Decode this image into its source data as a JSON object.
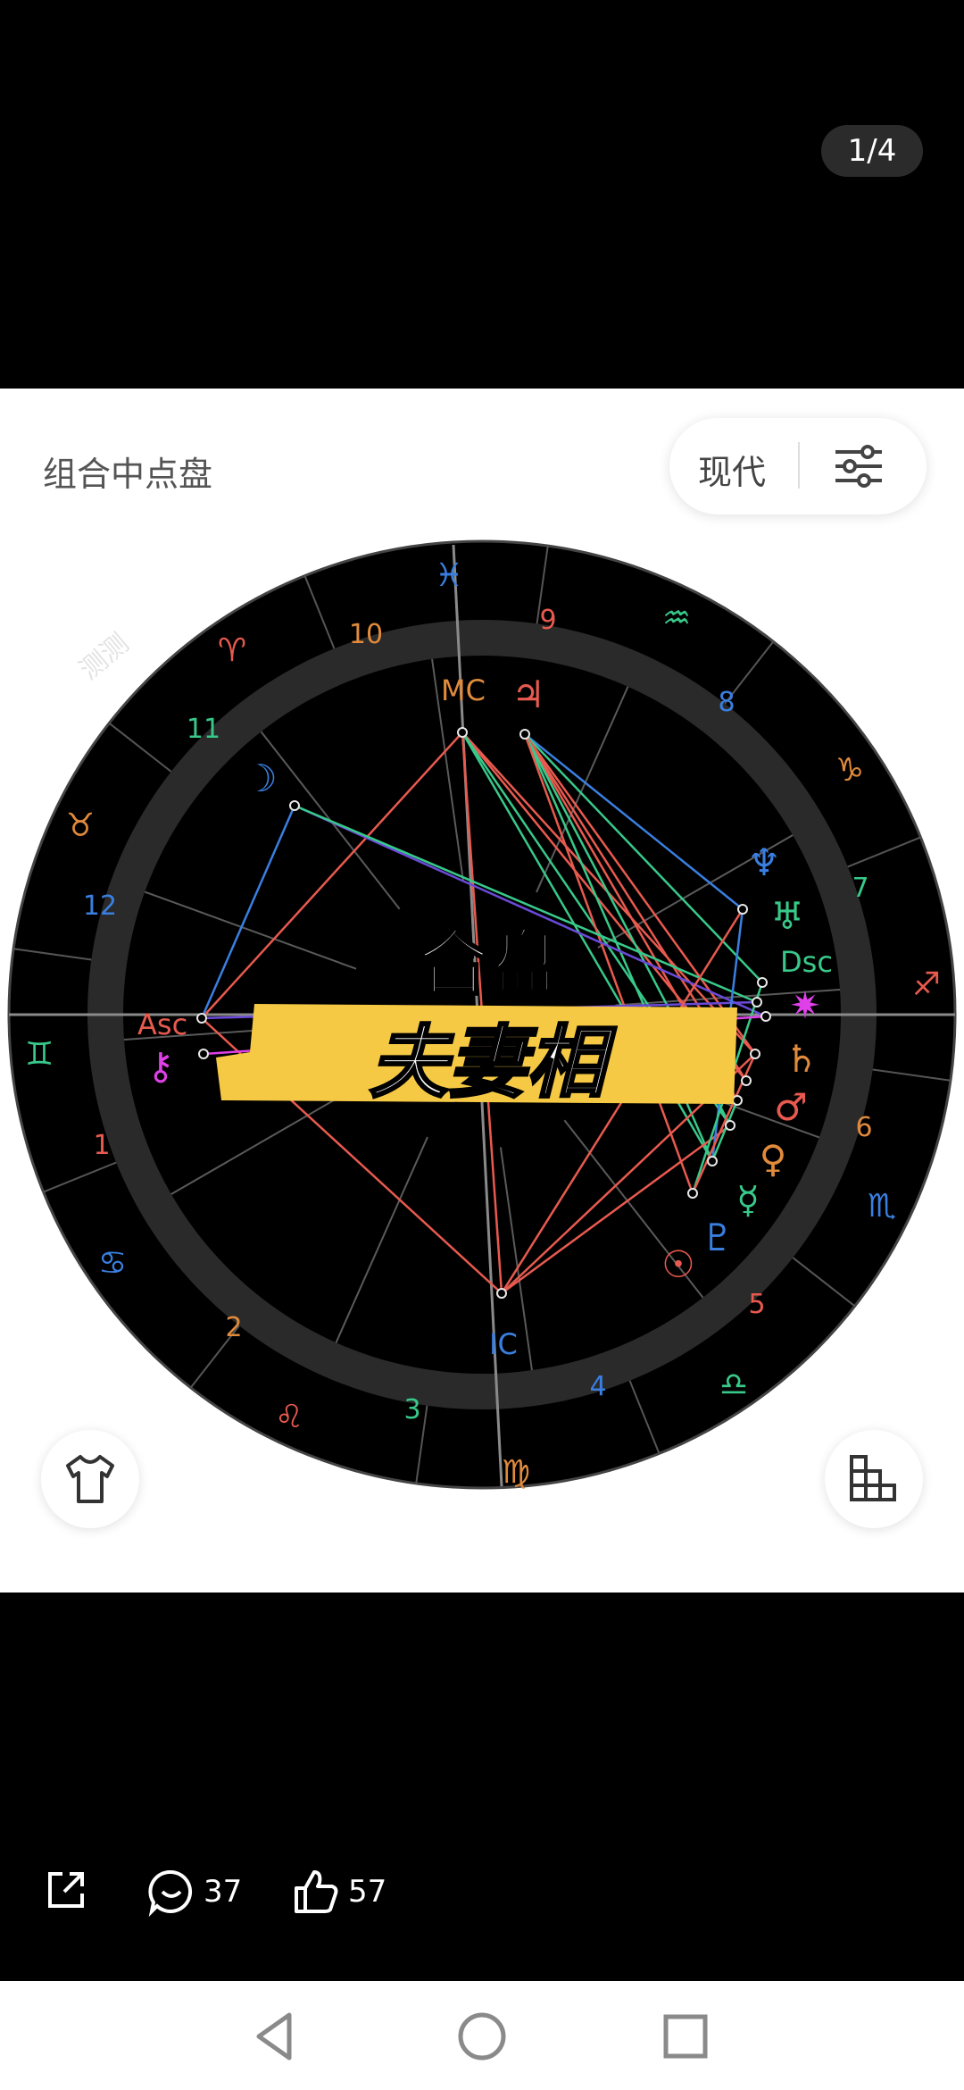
{
  "viewer": {
    "page_counter": "1/4"
  },
  "header": {
    "chart_name": "组合中点盘",
    "mode_label": "现代"
  },
  "chart": {
    "signs": [
      "♓",
      "♒",
      "♑",
      "♐",
      "♏",
      "♎",
      "♍",
      "♌",
      "♋",
      "♊",
      "♉",
      "♈"
    ],
    "house_numbers": [
      "1",
      "2",
      "3",
      "4",
      "5",
      "6",
      "7",
      "8",
      "9",
      "10",
      "11",
      "12"
    ],
    "angles": {
      "asc": "Asc",
      "dsc": "Dsc",
      "mc": "MC",
      "ic": "IC"
    },
    "planets": {
      "jupiter": "♃",
      "moon": "☽",
      "neptune": "♆",
      "uranus": "♅",
      "saturn": "♄",
      "mars": "♂",
      "venus": "♀",
      "mercury": "☿",
      "pluto": "♇",
      "sun": "☉",
      "chiron": "⚷",
      "node": "✷"
    },
    "overlay_line1": "合盘",
    "overlay_line2": "夫妻相",
    "watermark": "测测"
  },
  "actions": {
    "comment_count": "37",
    "like_count": "57"
  },
  "colors": {
    "fire": "#e85a4f",
    "water": "#3a7fe0",
    "earth": "#e08a3c",
    "air": "#38c98a",
    "magenta": "#e040e8",
    "banner": "#f6c945"
  }
}
